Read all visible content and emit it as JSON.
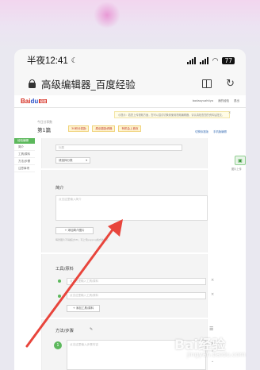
{
  "status_bar": {
    "time": "半夜12:41",
    "battery": "77"
  },
  "browser": {
    "page_title": "高级编辑器_百度经验"
  },
  "site": {
    "logo_text": "Bai",
    "logo_paw": "du",
    "logo_tag": "经验",
    "user_links": [
      "bodaoyuahtiyo",
      "我的经验",
      "退出"
    ]
  },
  "notice": {
    "text": "小提示：若您上传视频方面，您可以尝试切换到使用视频编辑器，请认真检查您的资料后提交。"
  },
  "header": {
    "count_label": "今日分享数",
    "count_value": "第1篇",
    "badges": [
      "30积分奖励",
      "原创激励资格",
      "有机会上首页"
    ],
    "right_links": [
      "切换标准版",
      "手机版编辑"
    ]
  },
  "left_nav": {
    "head": "经验编辑",
    "items": [
      "简介",
      "工具/原料",
      "方法/步骤",
      "注意事项"
    ]
  },
  "editor": {
    "title_placeholder": "标题",
    "category_label": "请选择分类",
    "intro_title": "简介",
    "intro_placeholder": "点击这里输入简介",
    "upload_label": "+ 添加简介图片",
    "upload_note": "每张图片不得超过5M，可上传jpg/png格式的图片",
    "tools_title": "工具/原料",
    "tool_placeholders": [
      "点击这里输入工具/原料",
      "点击这里输入工具/原料"
    ],
    "add_tool_label": "+ 添加工具/原料",
    "steps_title": "方法/步骤",
    "step_number": "1",
    "step_placeholder": "点击这里输入步骤内容"
  },
  "side_photo": {
    "label": "图片上传"
  },
  "watermark": {
    "text": "Bai经验",
    "sub": "jingyan.baidu.com"
  },
  "colors": {
    "arrow": "#e8453c",
    "accent_green": "#5cb85c",
    "logo_red": "#d52b1e"
  }
}
